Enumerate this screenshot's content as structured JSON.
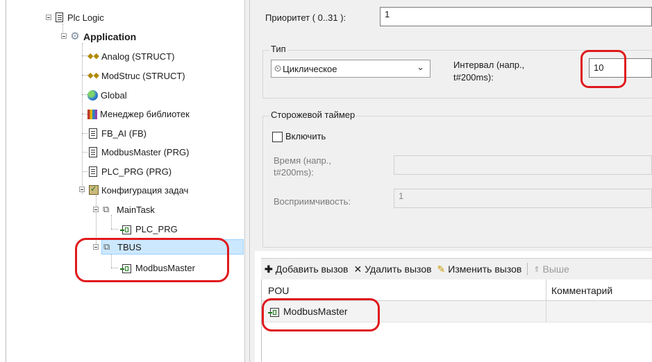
{
  "tree": {
    "items": [
      {
        "label": "Plc Logic",
        "icon": "plc-logic-icon"
      },
      {
        "label": "Application",
        "icon": "gear-icon"
      },
      {
        "label": "Analog (STRUCT)",
        "icon": "struct-icon"
      },
      {
        "label": "ModStruc (STRUCT)",
        "icon": "struct-icon"
      },
      {
        "label": "Global",
        "icon": "globe-icon"
      },
      {
        "label": "Менеджер библиотек",
        "icon": "library-icon"
      },
      {
        "label": "FB_AI (FB)",
        "icon": "document-icon"
      },
      {
        "label": "ModbusMaster (PRG)",
        "icon": "document-icon"
      },
      {
        "label": "PLC_PRG (PRG)",
        "icon": "document-icon"
      },
      {
        "label": "Конфигурация задач",
        "icon": "task-config-icon"
      },
      {
        "label": "MainTask",
        "icon": "task-icon"
      },
      {
        "label": "PLC_PRG",
        "icon": "program-call-icon"
      },
      {
        "label": "TBUS",
        "icon": "task-icon"
      },
      {
        "label": "ModbusMaster",
        "icon": "program-call-icon"
      }
    ]
  },
  "props": {
    "priority_label": "Приоритет ( 0..31 ):",
    "priority_value": "1",
    "type_group_title": "Тип",
    "type_select_value": "Циклическое",
    "type_icon": "clock-icon",
    "interval_label_1": "Интервал (напр.,",
    "interval_label_2": "t#200ms):",
    "interval_value": "10",
    "watchdog_title": "Сторожевой таймер",
    "enable_label": "Включить",
    "time_label_1": "Время (напр.,",
    "time_label_2": "t#200ms):",
    "time_value": "",
    "sensitivity_label": "Восприимчивость:",
    "sensitivity_value": "1"
  },
  "toolbar": {
    "add_call": "Добавить вызов",
    "remove_call": "Удалить вызов",
    "edit_call": "Изменить вызов",
    "move_up": "Выше"
  },
  "grid": {
    "columns": [
      "POU",
      "Комментарий"
    ],
    "rows": [
      {
        "pou": "ModbusMaster",
        "comment": ""
      }
    ]
  },
  "colors": {
    "annotation": "#e0191c",
    "selection": "#cce8ff",
    "panel_bg": "#f0f0f0"
  }
}
